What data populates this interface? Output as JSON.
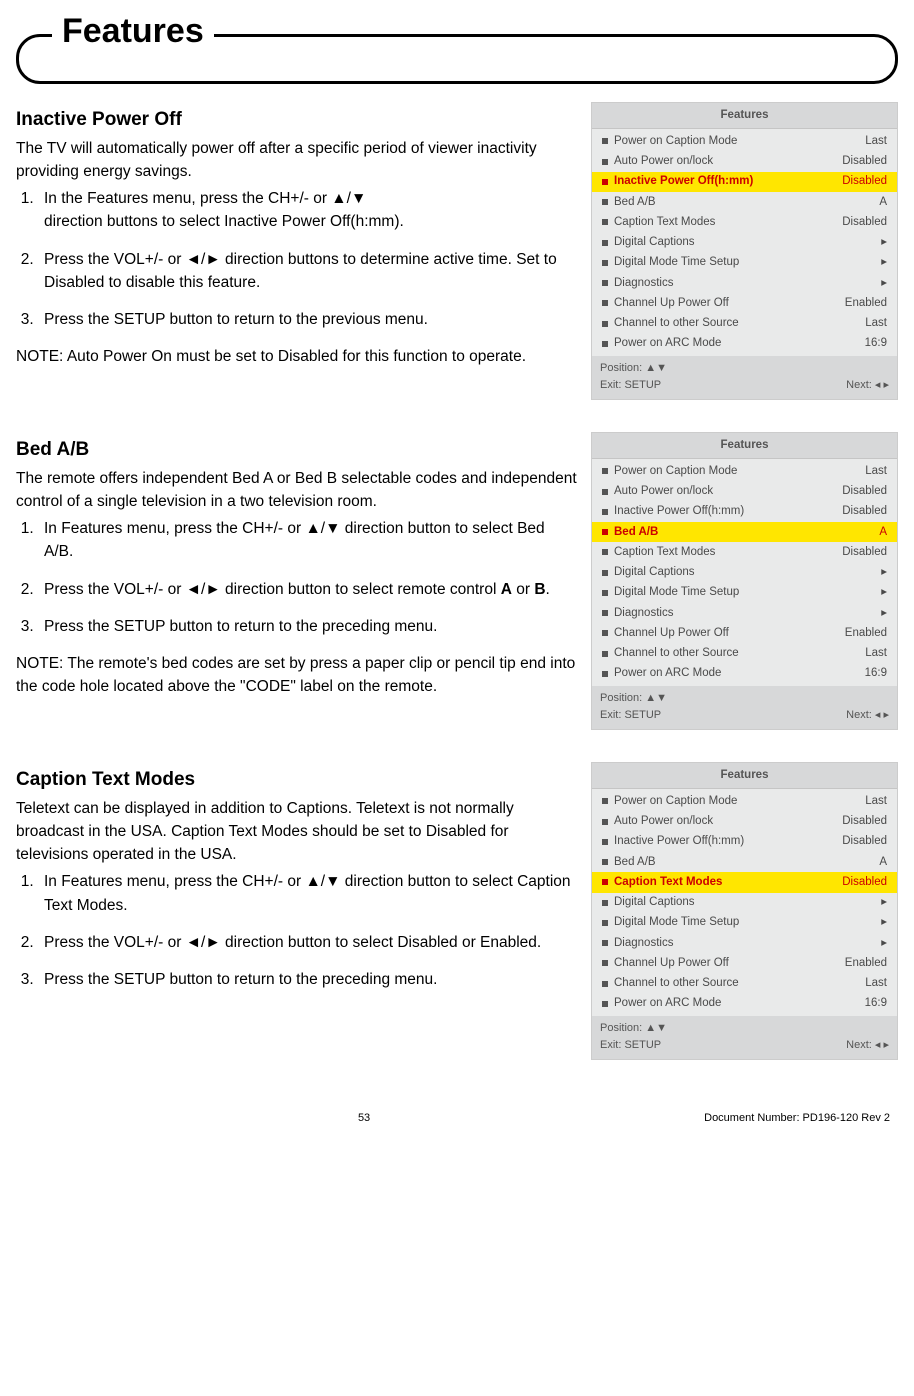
{
  "header": {
    "title": "Features"
  },
  "triangles": {
    "up": "▲",
    "down": "▼",
    "left": "◄",
    "right": "►",
    "rightSmall": "▸",
    "leftRightSmall": "◂ ▸"
  },
  "menuFooter": {
    "position": "Position: ▲▼",
    "exit": "Exit: SETUP",
    "next": "Next: ◂ ▸"
  },
  "menuTitle": "Features",
  "menuItems": [
    {
      "label": "Power on Caption Mode",
      "value": "Last"
    },
    {
      "label": "Auto Power on/lock",
      "value": "Disabled"
    },
    {
      "label": "Inactive Power Off(h:mm)",
      "value": "Disabled"
    },
    {
      "label": "Bed A/B",
      "value": "A"
    },
    {
      "label": "Caption Text Modes",
      "value": "Disabled"
    },
    {
      "label": "Digital Captions",
      "value": "▸"
    },
    {
      "label": "Digital Mode Time Setup",
      "value": "▸"
    },
    {
      "label": "Diagnostics",
      "value": "▸"
    },
    {
      "label": "Channel Up Power Off",
      "value": "Enabled"
    },
    {
      "label": "Channel to other Source",
      "value": "Last"
    },
    {
      "label": "Power on ARC Mode",
      "value": "16:9"
    }
  ],
  "highlights": {
    "sec1": 2,
    "sec2": 3,
    "sec3": 4
  },
  "sec1": {
    "heading": "Inactive Power Off",
    "intro": "The TV will automatically power off after a specific period of viewer inactivity providing energy savings.",
    "step1a": "In the Features menu, press the CH+/- or ▲/▼",
    "step1b": "direction buttons to select Inactive Power Off(h:mm).",
    "step2": "Press the VOL+/- or ◄/► direction buttons to determine active time. Set to Disabled to disable this feature.",
    "step3": "Press the SETUP button to return to the previous menu.",
    "note": "NOTE: Auto Power On must be set to Disabled for this function to operate."
  },
  "sec2": {
    "heading": "Bed A/B",
    "intro": "The remote offers independent Bed A or Bed B selectable codes and independent control of a single television in a two television room.",
    "step1": "In Features menu, press the CH+/- or ▲/▼ direction button to select Bed A/B.",
    "step2a": "Press the VOL+/- or ◄/► direction button to select remote control ",
    "step2b": " or ",
    "step2c": ".",
    "A": "A",
    "B": "B",
    "step3": "Press the SETUP button to return to the preceding menu.",
    "note": "NOTE: The remote's bed codes are set by press a paper clip or pencil tip end into the code hole located above the \"CODE\" label on the remote."
  },
  "sec3": {
    "heading": "Caption Text Modes",
    "intro": "Teletext can be displayed in addition to Captions. Teletext is not normally broadcast in the USA. Caption Text Modes should be set to Disabled for televisions operated in the USA.",
    "step1": "In Features menu, press the CH+/- or ▲/▼ direction button to select Caption Text Modes.",
    "step2": "Press the VOL+/- or ◄/► direction button to select Disabled or Enabled.",
    "step3": "Press the SETUP button to return to the preceding menu."
  },
  "footer": {
    "pageNum": "53",
    "doc": "Document Number: PD196-120 Rev 2"
  }
}
